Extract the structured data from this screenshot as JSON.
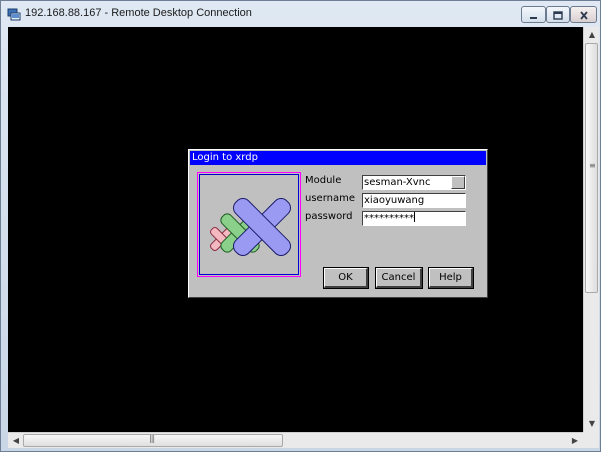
{
  "window": {
    "title": "192.168.88.167 - Remote Desktop Connection",
    "icon": "remote-desktop-icon"
  },
  "dialog": {
    "title": "Login to xrdp",
    "logo": "xrdp-logo",
    "module_label": "Module",
    "module_value": "sesman-Xvnc",
    "username_label": "username",
    "username_value": "xiaoyuwang",
    "password_label": "password",
    "password_value": "**********",
    "ok_label": "OK",
    "cancel_label": "Cancel",
    "help_label": "Help"
  },
  "colors": {
    "titlebar_blue": "#0000ff",
    "dialog_gray": "#c0c0c0",
    "remote_background": "#000000"
  }
}
